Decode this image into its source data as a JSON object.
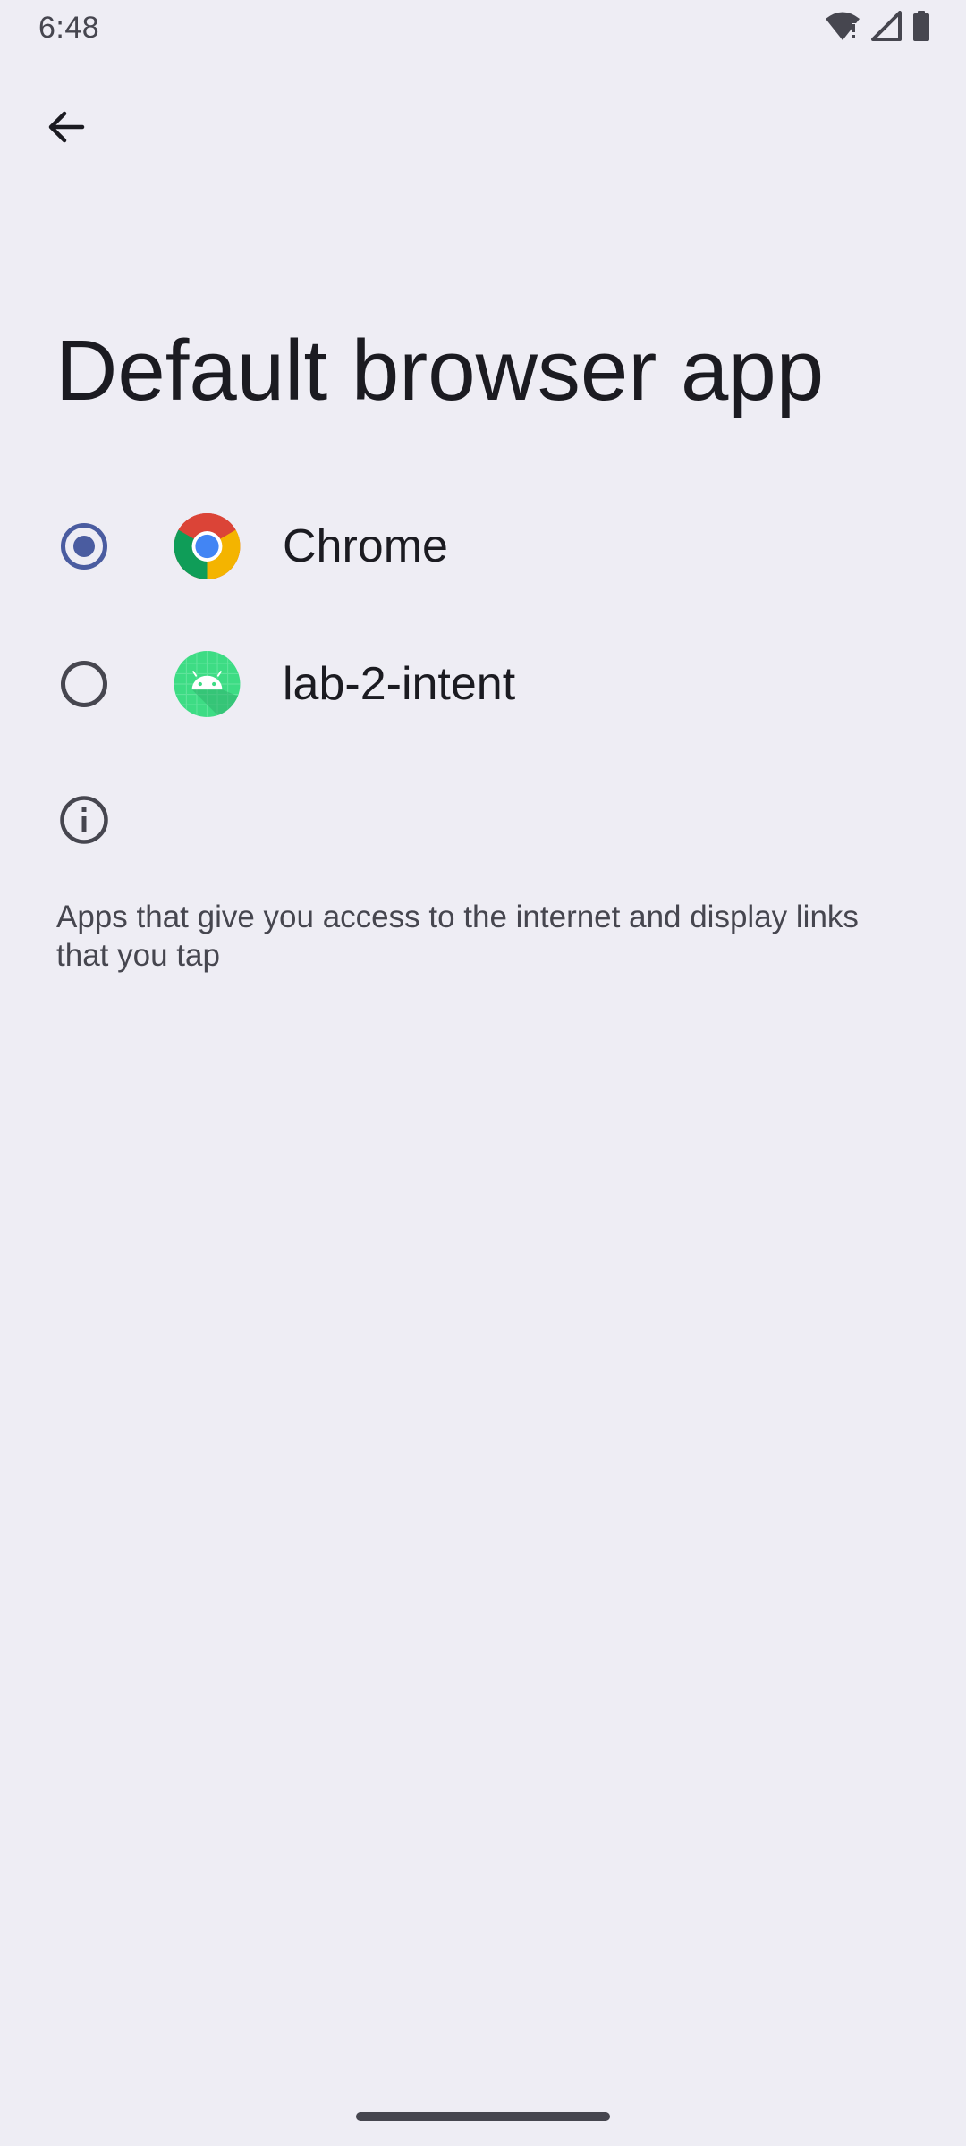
{
  "status_bar": {
    "time": "6:48",
    "icons": [
      "wifi-alert-icon",
      "signal-icon",
      "battery-icon"
    ]
  },
  "header": {
    "back_icon": "arrow-back-icon",
    "title": "Default browser app"
  },
  "options": [
    {
      "label": "Chrome",
      "icon": "chrome-icon",
      "selected": true
    },
    {
      "label": "lab-2-intent",
      "icon": "android-app-icon",
      "selected": false
    }
  ],
  "info": {
    "icon": "info-icon",
    "text": "Apps that give you access to the internet and display links that you tap"
  },
  "colors": {
    "background": "#EEEDF4",
    "accent": "#4A5CA0",
    "text_primary": "#1B1B21",
    "text_secondary": "#46464F"
  }
}
